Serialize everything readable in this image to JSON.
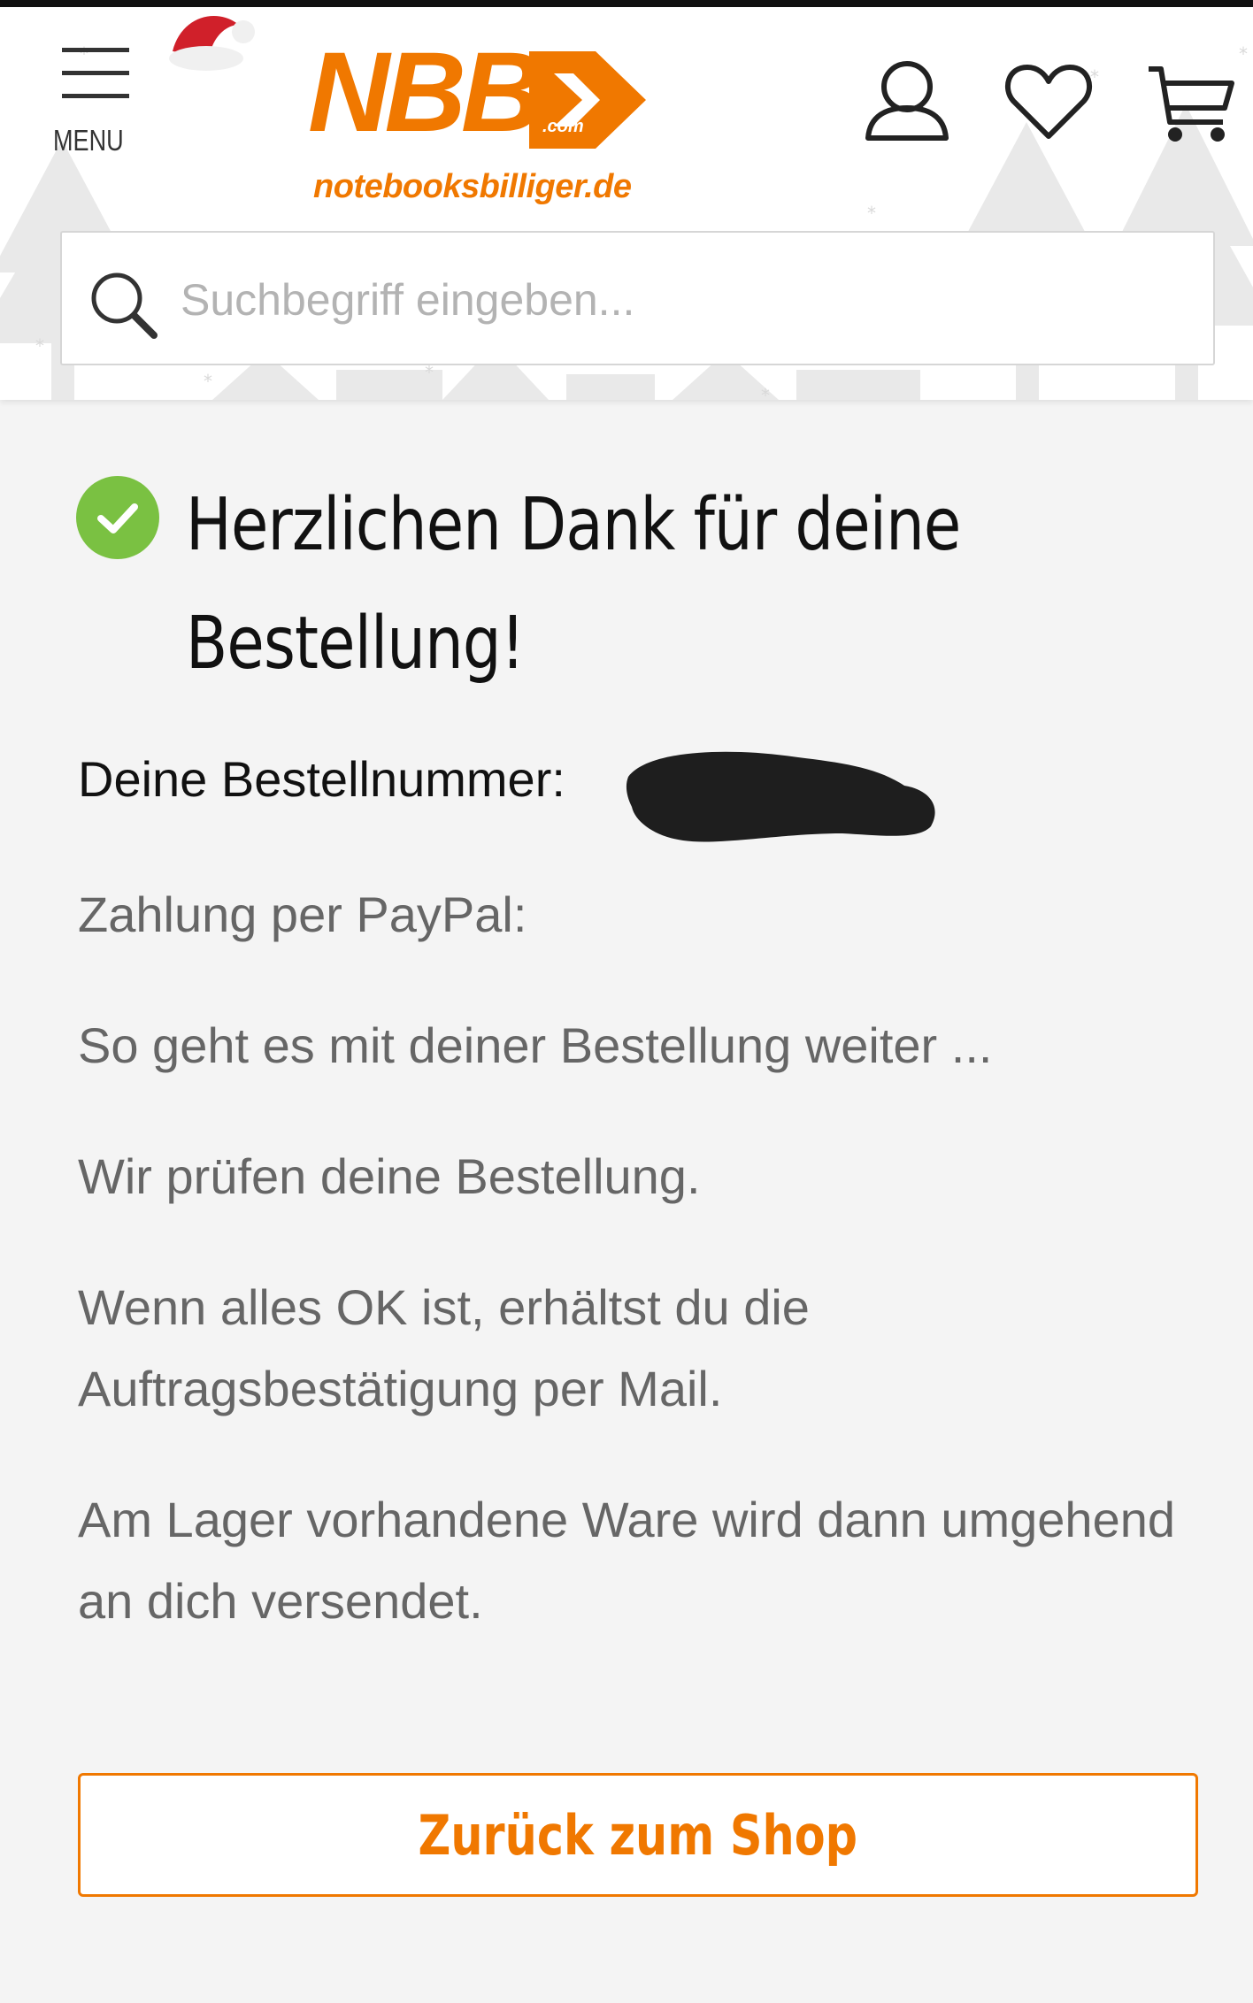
{
  "header": {
    "menu_label": "MENU",
    "logo": {
      "wordmark": "NBB",
      "domain_badge": ".com",
      "tagline": "notebooksbilliger.de"
    },
    "icons": {
      "account": "user-icon",
      "wishlist": "heart-icon",
      "cart": "cart-icon",
      "menu": "hamburger-icon",
      "seasonal": "santa-hat-icon"
    },
    "search": {
      "placeholder": "Suchbegriff eingeben...",
      "value": ""
    }
  },
  "confirmation": {
    "title_line1": "Herzlichen Dank für deine",
    "title_line2": "Bestellung!",
    "order_number_label": "Deine Bestellnummer:",
    "payment": "Zahlung per PayPal:",
    "next_steps": "So geht es mit deiner Bestellung weiter ...",
    "step_check": "Wir prüfen deine Bestellung.",
    "step_mail": "Wenn alles OK ist, erhältst du die Auftragsbestätigung per Mail.",
    "step_shipping": "Am Lager vorhandene Ware wird dann umgehend an dich versendet."
  },
  "actions": {
    "back_to_shop": "Zurück zum Shop"
  },
  "colors": {
    "brand_orange": "#f07800",
    "success_green": "#7ac142",
    "text_dark": "#111111",
    "text_muted": "#666666",
    "background": "#f4f4f4"
  }
}
